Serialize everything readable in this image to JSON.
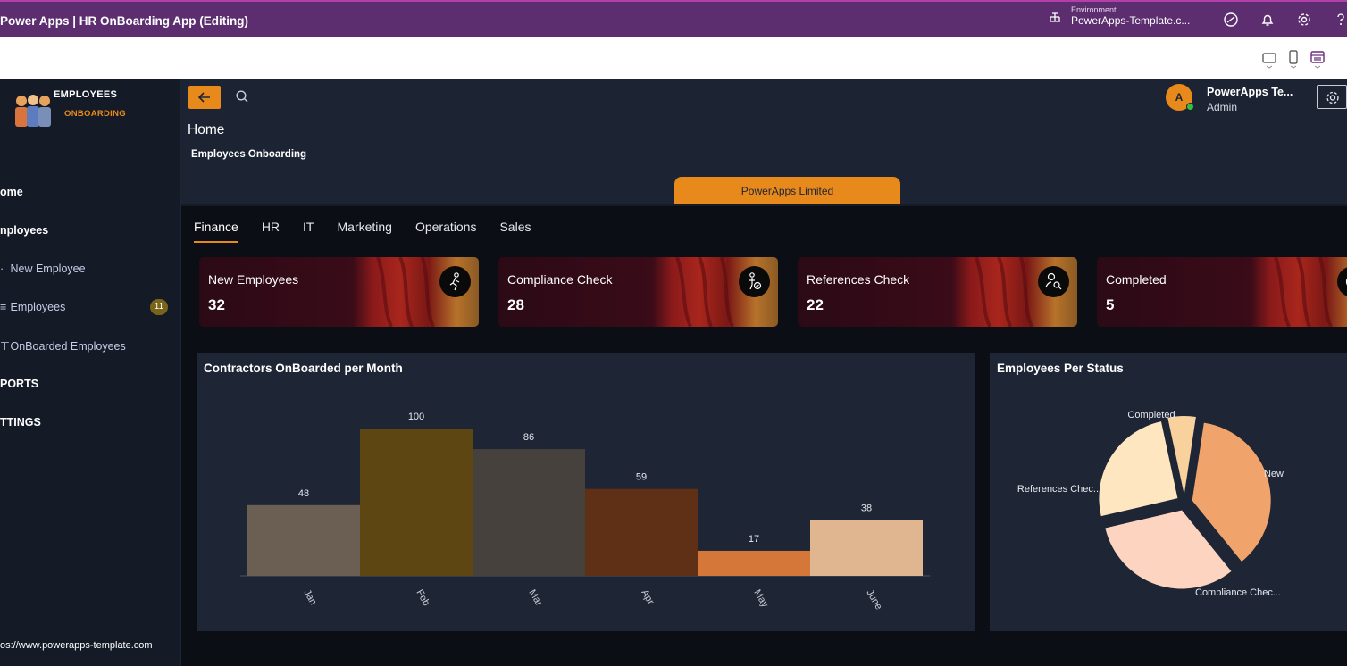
{
  "app": {
    "title": "Power Apps  |  HR OnBoarding App (Editing)",
    "environment_label": "Environment",
    "environment_value": "PowerApps-Template.c..."
  },
  "sidebar": {
    "logo_line1": "EMPLOYEES",
    "logo_line2": "ONBOARDING",
    "items": [
      {
        "label": "ome"
      },
      {
        "label": "nployees"
      },
      {
        "label": "New Employee"
      },
      {
        "label": "Employees",
        "badge": "11"
      },
      {
        "label": "OnBoarded Employees"
      },
      {
        "label": "PORTS"
      },
      {
        "label": "TTINGS"
      }
    ],
    "footer_url": "os://www.powerapps-template.com"
  },
  "header": {
    "user_initial": "A",
    "user_name": "PowerApps Te...",
    "user_role": "Admin",
    "page_title": "Home",
    "page_subtitle": "Employees Onboarding",
    "company_tab": "PowerApps Limited"
  },
  "tabs": [
    "Finance",
    "HR",
    "IT",
    "Marketing",
    "Operations",
    "Sales"
  ],
  "cards": [
    {
      "label": "New Employees",
      "value": "32",
      "icon": "person-walking-icon"
    },
    {
      "label": "Compliance Check",
      "value": "28",
      "icon": "person-check-icon"
    },
    {
      "label": "References Check",
      "value": "22",
      "icon": "person-search-icon"
    },
    {
      "label": "Completed",
      "value": "5",
      "icon": "checkmark-icon"
    }
  ],
  "colors": {
    "accent": "#e8891c",
    "topbar": "#5c2d6f",
    "panel": "#1e2535",
    "sidebar": "#141a26"
  },
  "chart_data": [
    {
      "type": "bar",
      "title": "Contractors OnBoarded per Month",
      "categories": [
        "Jan",
        "Feb",
        "Mar",
        "Apr",
        "May",
        "June"
      ],
      "values": [
        48,
        100,
        86,
        59,
        17,
        38
      ],
      "colors": [
        "#6b5e52",
        "#5e4613",
        "#47413e",
        "#5f3015",
        "#d6773a",
        "#e0b690"
      ],
      "ylim": [
        0,
        100
      ],
      "data_labels": true
    },
    {
      "type": "pie",
      "title": "Employees Per Status",
      "labels": [
        "New",
        "Compliance Chec...",
        "References Chec...",
        "Completed"
      ],
      "values": [
        32,
        28,
        22,
        5
      ],
      "colors": [
        "#f0a46c",
        "#fcd4bf",
        "#fde6c0",
        "#f8d19c"
      ]
    }
  ]
}
